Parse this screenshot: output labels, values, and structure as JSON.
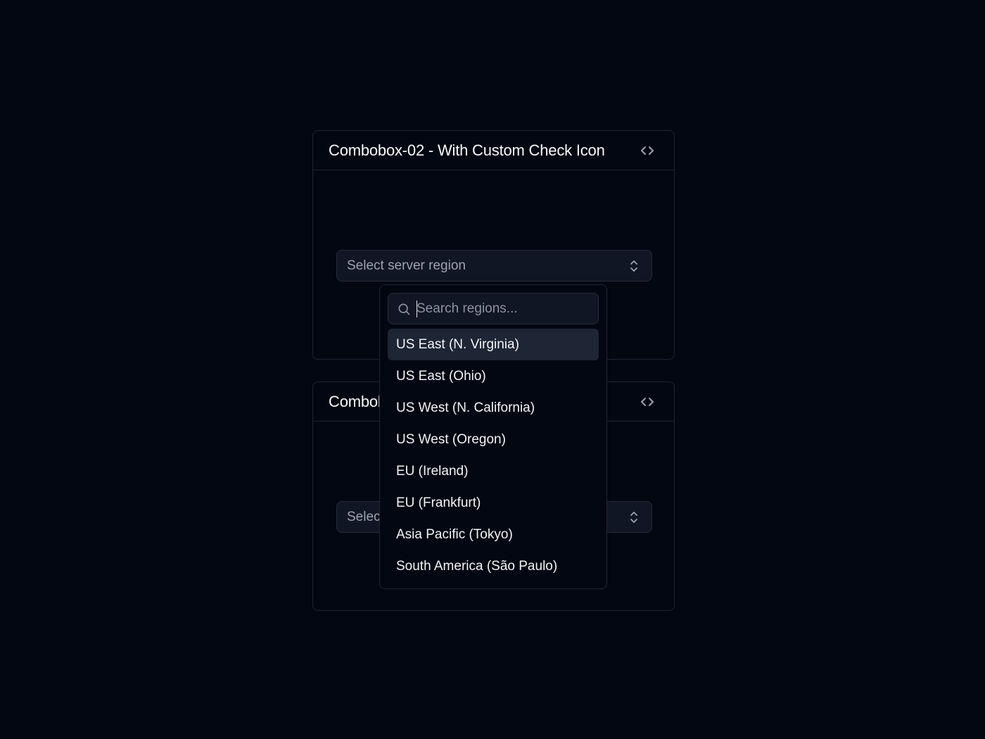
{
  "cards": [
    {
      "title": "Combobox-02 - With Custom Check Icon",
      "trigger_placeholder": "Select server region"
    },
    {
      "title": "Combobox",
      "trigger_placeholder": "Select server region"
    }
  ],
  "popover": {
    "search_placeholder": "Search regions...",
    "search_value": "",
    "options": [
      "US East (N. Virginia)",
      "US East (Ohio)",
      "US West (N. California)",
      "US West (Oregon)",
      "EU (Ireland)",
      "EU (Frankfurt)",
      "Asia Pacific (Tokyo)",
      "South America (São Paulo)"
    ],
    "highlighted_index": 0
  },
  "icons": {
    "code": "code-icon",
    "chevrons": "chevrons-up-down-icon",
    "search": "search-icon"
  },
  "colors": {
    "background": "#030712",
    "border": "#1f2433",
    "input_bg": "#111624",
    "highlight": "#1e2535",
    "text": "#f3f4f6",
    "muted": "#9ca3af"
  }
}
